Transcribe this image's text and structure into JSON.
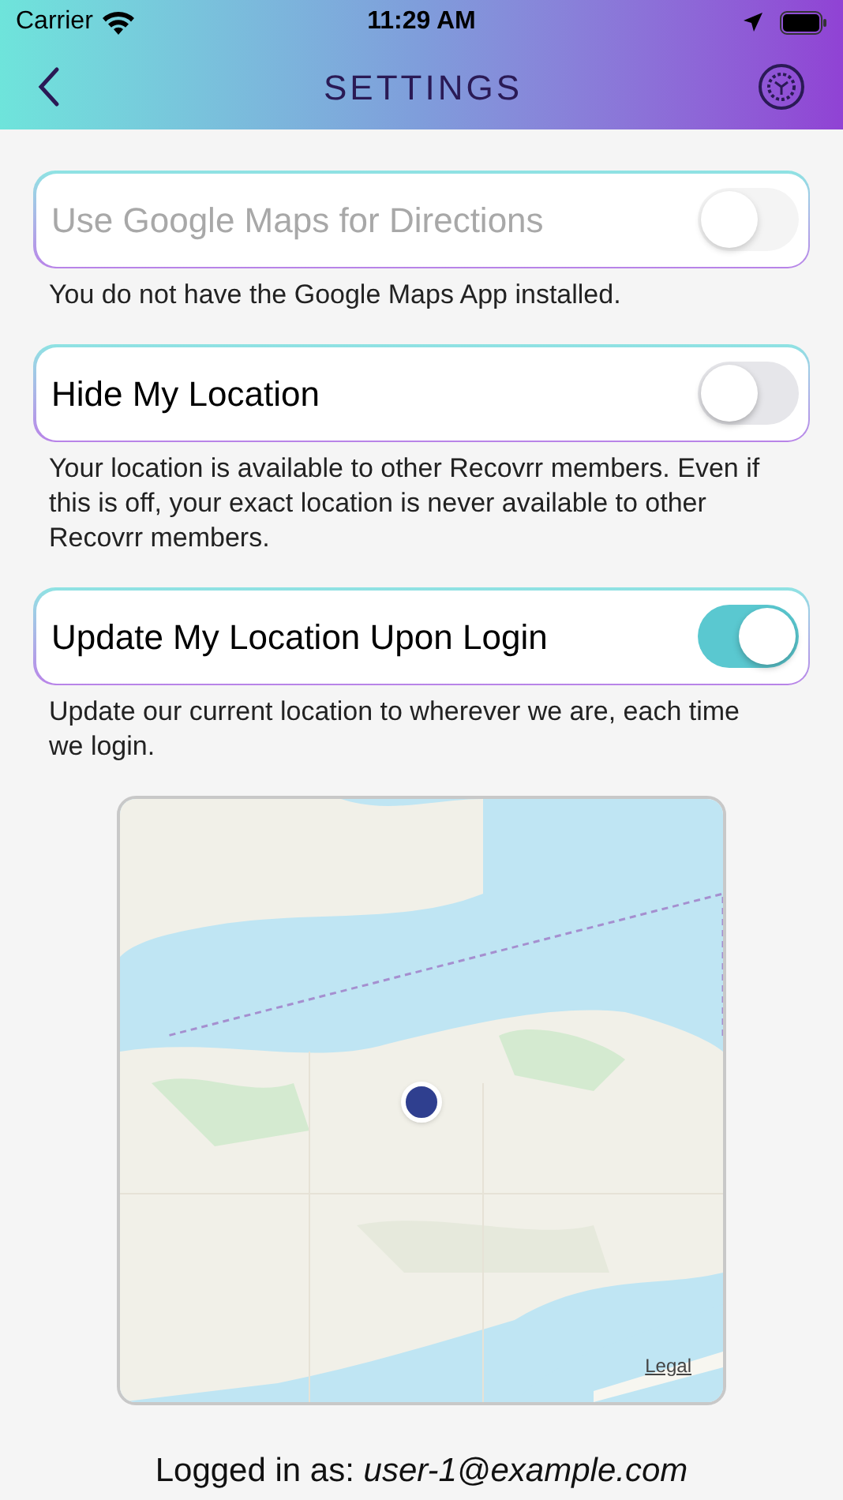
{
  "status_bar": {
    "carrier": "Carrier",
    "time": "11:29 AM"
  },
  "nav": {
    "title": "SETTINGS"
  },
  "settings": [
    {
      "label": "Use Google Maps for Directions",
      "on": false,
      "disabled": true,
      "note": "You do not have the Google Maps App installed."
    },
    {
      "label": "Hide My Location",
      "on": false,
      "disabled": false,
      "note": "Your location is available to other Recovrr members. Even if this is off, your exact location is never available to other Recovrr members."
    },
    {
      "label": "Update My Location Upon Login",
      "on": true,
      "disabled": false,
      "note": "Update our current location to wherever we are, each time we login."
    }
  ],
  "map": {
    "legal": "Legal"
  },
  "footer": "Logged in as: *user-1@example.com*"
}
